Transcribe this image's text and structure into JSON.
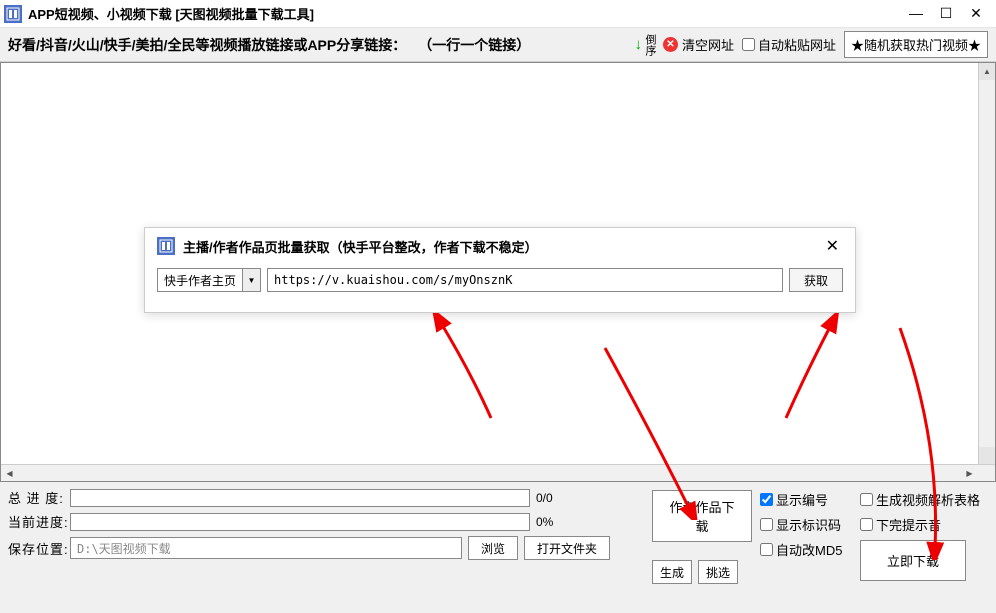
{
  "window": {
    "title": "APP短视频、小视频下载 [天图视频批量下载工具]"
  },
  "toolbar": {
    "label": "好看/抖音/火山/快手/美拍/全民等视频播放链接或APP分享链接：",
    "hint": "（一行一个链接）",
    "sort": "倒序",
    "clear": "清空网址",
    "autopaste": "自动粘贴网址",
    "hot": "★随机获取热门视频★"
  },
  "dialog": {
    "title": "主播/作者作品页批量获取（快手平台整改，作者下载不稳定）",
    "select_value": "快手作者主页",
    "url": "https://v.kuaishou.com/s/myOnsznK",
    "fetch": "获取"
  },
  "bottom": {
    "total_progress_label": "总 进 度:",
    "current_progress_label": "当前进度:",
    "total_progress_text": "0/0",
    "current_progress_text": "0%",
    "save_label": "保存位置:",
    "save_path": "D:\\天图视频下载",
    "browse": "浏览",
    "open_folder": "打开文件夹",
    "generate": "生成",
    "pick": "挑选",
    "author_download": "作者作品下载",
    "show_number": "显示编号",
    "show_id": "显示标识码",
    "auto_md5": "自动改MD5",
    "gen_parse_table": "生成视频解析表格",
    "done_notify": "下完提示音",
    "download_now": "立即下载"
  }
}
